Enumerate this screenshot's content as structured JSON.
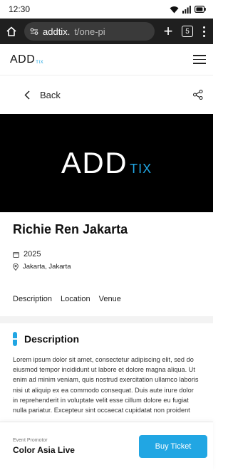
{
  "status_bar": {
    "time": "12:30"
  },
  "browser": {
    "url_host": "addtix.",
    "url_path": "t/one-pi",
    "tab_count": "5",
    "icons": [
      "home-icon",
      "site-settings-icon",
      "new-tab-icon",
      "tab-switcher-icon",
      "more-vert-icon"
    ]
  },
  "site": {
    "logo_main": "ADD",
    "logo_sub": "TIX"
  },
  "nav": {
    "back_label": "Back"
  },
  "banner": {
    "logo_main": "ADD",
    "logo_sub": "TIX"
  },
  "event": {
    "title": "Richie Ren Jakarta",
    "year": "2025",
    "location": "Jakarta, Jakarta"
  },
  "tabs": {
    "description": "Description",
    "location": "Location",
    "venue": "Venue"
  },
  "section": {
    "title": "Description",
    "body": "Lorem ipsum dolor sit amet, consectetur adipiscing elit, sed do eiusmod tempor incididunt ut labore et dolore magna aliqua. Ut enim ad minim veniam, quis nostrud exercitation ullamco laboris nisi ut aliquip ex ea commodo consequat. Duis aute irure dolor in reprehenderit in voluptate velit esse cillum dolore eu fugiat nulla pariatur. Excepteur sint occaecat cupidatat non proident"
  },
  "footer": {
    "promotor_label": "Event Promotor",
    "promotor_name": "Color Asia Live",
    "buy_label": "Buy Ticket"
  },
  "colors": {
    "accent": "#21a6e3",
    "browser_bar": "#1f1f1f",
    "banner_bg": "#000000"
  }
}
